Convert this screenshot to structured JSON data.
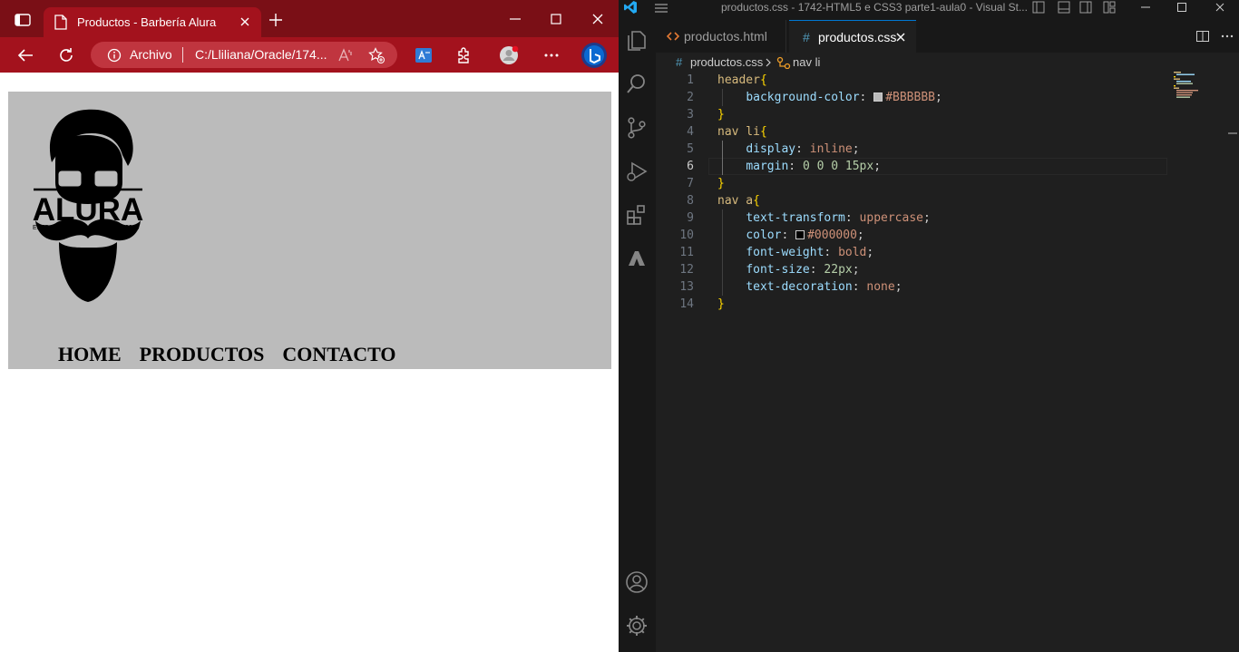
{
  "browser": {
    "tab_title": "Productos - Barbería Alura",
    "omnibox": {
      "scheme_label": "Archivo",
      "url": "C:/Lliliana/Oracle/174..."
    },
    "page": {
      "header_bg": "#BBBBBB",
      "logo": {
        "brand": "ALURA",
        "left_tag": "ESTD",
        "right_tag": "2020"
      },
      "nav": [
        "Home",
        "Productos",
        "Contacto"
      ]
    }
  },
  "vscode": {
    "window_title": "productos.css - 1742-HTML5 e CSS3 parte1-aula0 - Visual St...",
    "tabs": [
      {
        "label": "productos.html",
        "active": false
      },
      {
        "label": "productos.css",
        "active": true
      }
    ],
    "breadcrumb": {
      "file": "productos.css",
      "symbol": "nav li"
    },
    "current_line": 6,
    "code": [
      {
        "n": "1",
        "tokens": [
          {
            "t": "header",
            "c": "sel"
          },
          {
            "t": "{",
            "c": "brace"
          }
        ]
      },
      {
        "n": "2",
        "tokens": [
          {
            "t": "    ",
            "c": ""
          },
          {
            "t": "background-color",
            "c": "prop"
          },
          {
            "t": ": ",
            "c": ""
          },
          {
            "t": "",
            "c": "swatch",
            "color": "#BBBBBB"
          },
          {
            "t": "#BBBBBB",
            "c": "val"
          },
          {
            "t": ";",
            "c": ""
          }
        ]
      },
      {
        "n": "3",
        "tokens": [
          {
            "t": "}",
            "c": "brace"
          }
        ]
      },
      {
        "n": "4",
        "tokens": [
          {
            "t": "nav li",
            "c": "sel"
          },
          {
            "t": "{",
            "c": "brace"
          }
        ]
      },
      {
        "n": "5",
        "tokens": [
          {
            "t": "    ",
            "c": ""
          },
          {
            "t": "display",
            "c": "prop"
          },
          {
            "t": ": ",
            "c": ""
          },
          {
            "t": "inline",
            "c": "val"
          },
          {
            "t": ";",
            "c": ""
          }
        ]
      },
      {
        "n": "6",
        "tokens": [
          {
            "t": "    ",
            "c": ""
          },
          {
            "t": "margin",
            "c": "prop"
          },
          {
            "t": ": ",
            "c": ""
          },
          {
            "t": "0 0 0 15px",
            "c": "num"
          },
          {
            "t": ";",
            "c": ""
          }
        ]
      },
      {
        "n": "7",
        "tokens": [
          {
            "t": "}",
            "c": "brace"
          }
        ]
      },
      {
        "n": "8",
        "tokens": [
          {
            "t": "nav a",
            "c": "sel"
          },
          {
            "t": "{",
            "c": "brace"
          }
        ]
      },
      {
        "n": "9",
        "tokens": [
          {
            "t": "    ",
            "c": ""
          },
          {
            "t": "text-transform",
            "c": "prop"
          },
          {
            "t": ": ",
            "c": ""
          },
          {
            "t": "uppercase",
            "c": "val"
          },
          {
            "t": ";",
            "c": ""
          }
        ]
      },
      {
        "n": "10",
        "tokens": [
          {
            "t": "    ",
            "c": ""
          },
          {
            "t": "color",
            "c": "prop"
          },
          {
            "t": ": ",
            "c": ""
          },
          {
            "t": "",
            "c": "swatch",
            "color": "#000000"
          },
          {
            "t": "#000000",
            "c": "val"
          },
          {
            "t": ";",
            "c": ""
          }
        ]
      },
      {
        "n": "11",
        "tokens": [
          {
            "t": "    ",
            "c": ""
          },
          {
            "t": "font-weight",
            "c": "prop"
          },
          {
            "t": ": ",
            "c": ""
          },
          {
            "t": "bold",
            "c": "val"
          },
          {
            "t": ";",
            "c": ""
          }
        ]
      },
      {
        "n": "12",
        "tokens": [
          {
            "t": "    ",
            "c": ""
          },
          {
            "t": "font-size",
            "c": "prop"
          },
          {
            "t": ": ",
            "c": ""
          },
          {
            "t": "22px",
            "c": "num"
          },
          {
            "t": ";",
            "c": ""
          }
        ]
      },
      {
        "n": "13",
        "tokens": [
          {
            "t": "    ",
            "c": ""
          },
          {
            "t": "text-decoration",
            "c": "prop"
          },
          {
            "t": ": ",
            "c": ""
          },
          {
            "t": "none",
            "c": "val"
          },
          {
            "t": ";",
            "c": ""
          }
        ]
      },
      {
        "n": "14",
        "tokens": [
          {
            "t": "}",
            "c": "brace"
          }
        ]
      }
    ]
  }
}
